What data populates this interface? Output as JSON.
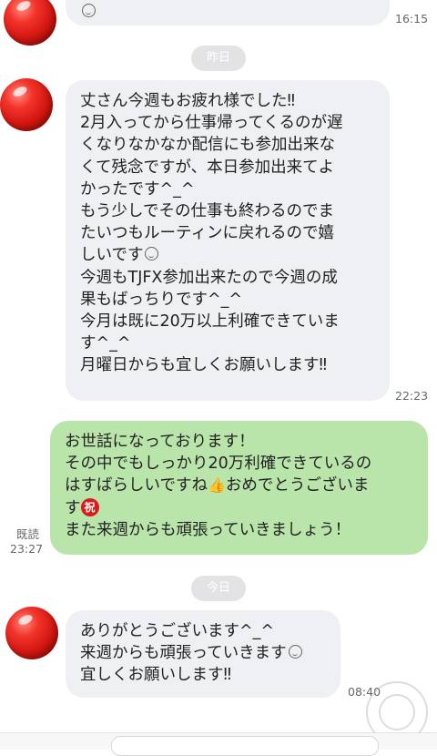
{
  "chat": {
    "messages": [
      {
        "side": "in",
        "time": "16:15",
        "lines": []
      },
      {
        "side": "in",
        "time": "22:23",
        "lines": [
          "丈さん今週もお疲れ様でした‼",
          "2月入ってから仕事帰ってくるのが遅",
          "くなりなかなか配信にも参加出来な",
          "くて残念ですが、本日参加出来てよ",
          "かったです^_^",
          "もう少しでその仕事も終わるのでま",
          "たいつもルーティンに戻れるので嬉",
          "しいです",
          "今週もTJFX参加出来たので今週の成",
          "果もばっちりです^_^",
          "今月は既に20万以上利確できていま",
          "す^_^",
          "月曜日からも宜しくお願いします‼"
        ]
      },
      {
        "side": "out",
        "read_label": "既読",
        "time": "23:27",
        "lines": [
          "お世話になっております！",
          "その中でもしっかり20万利確できているの",
          "はすばらしいですね",
          "おめでとうございま",
          "す",
          "また来週からも頑張っていきましょう！"
        ]
      },
      {
        "side": "in",
        "time": "08:40",
        "lines": [
          "ありがとうございます^_^",
          "来週からも頑張っていきます",
          "宜しくお願いします‼"
        ]
      }
    ],
    "dividers": [
      "昨日",
      "今日"
    ],
    "iwai_char": "祝"
  },
  "icons": [
    "avatar",
    "smiley-emoji-icon",
    "thumbs-up-emoji-icon",
    "celebration-stamp-icon",
    "watermark-emblem"
  ],
  "colors": {
    "incoming_bubble": "#eff0f3",
    "outgoing_bubble": "#b9e5ab",
    "avatar_red": "#d11610",
    "divider_pill": "#e3e3e6"
  }
}
